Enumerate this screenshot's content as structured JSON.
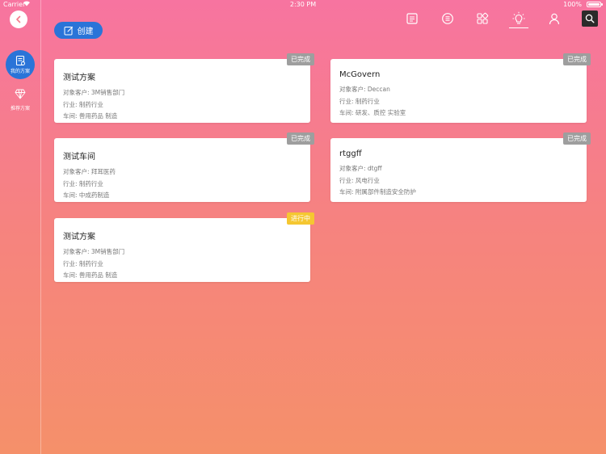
{
  "status_bar": {
    "carrier": "Carrier",
    "time": "2:30 PM",
    "battery": "100%",
    "battery_level": 1.0
  },
  "sidebar": {
    "items": [
      {
        "label": "我的方案",
        "icon": "doc-stack-icon",
        "active": true
      },
      {
        "label": "推荐方案",
        "icon": "diamond-icon",
        "active": false
      }
    ]
  },
  "toolbar": {
    "create_label": "创建",
    "icons": [
      "document-icon",
      "list-icon",
      "grid-icon",
      "lightbulb-icon",
      "user-icon",
      "search-icon"
    ],
    "active_icon": "lightbulb-icon"
  },
  "colors": {
    "accent": "#2a74d8",
    "badge_done": "#9e9e9e",
    "badge_progress": "#f5c731"
  },
  "cards": [
    {
      "title": "测试方案",
      "customer": "对象客户: 3M销售部门",
      "industry": "行业: 制药行业",
      "workshop": "车间: 兽用药品 制造",
      "status": "已完成",
      "status_type": "done"
    },
    {
      "title": "McGovern",
      "customer": "对象客户: Deccan",
      "industry": "行业: 制药行业",
      "workshop": "车间: 研发、质控 实验室",
      "status": "已完成",
      "status_type": "done"
    },
    {
      "title": "测试车间",
      "customer": "对象客户: 拜耳医药",
      "industry": "行业: 制药行业",
      "workshop": "车间: 中成药制造",
      "status": "已完成",
      "status_type": "done"
    },
    {
      "title": "rtggff",
      "customer": "对象客户: dtgff",
      "industry": "行业: 风电行业",
      "workshop": "车间: 附属部件制造安全防护",
      "status": "已完成",
      "status_type": "done"
    },
    {
      "title": "测试方案",
      "customer": "对象客户: 3M销售部门",
      "industry": "行业: 制药行业",
      "workshop": "车间: 兽用药品 制造",
      "status": "进行中",
      "status_type": "progress"
    }
  ]
}
